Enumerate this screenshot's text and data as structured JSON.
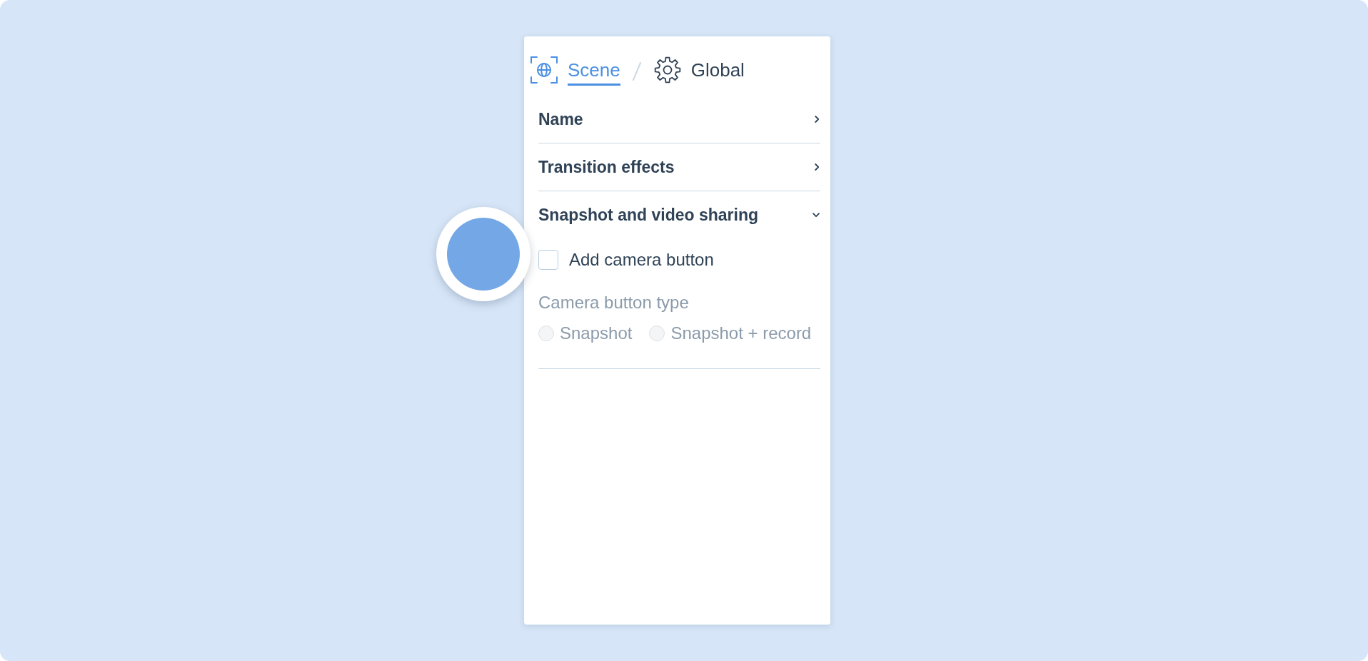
{
  "breadcrumb": [
    {
      "label": "Scene",
      "selected": true
    },
    {
      "label": "Global",
      "selected": false
    }
  ],
  "sections": [
    {
      "title": "Name",
      "expanded": false
    },
    {
      "title": "Transition effects",
      "expanded": false
    },
    {
      "title": "Snapshot and video sharing",
      "expanded": true,
      "checkbox": {
        "label": "Add camera button",
        "checked": false
      },
      "radio_group": {
        "label": "Camera button type",
        "disabled": true,
        "options": [
          {
            "label": "Snapshot",
            "selected": false
          },
          {
            "label": "Snapshot + record",
            "selected": false
          }
        ]
      }
    }
  ]
}
